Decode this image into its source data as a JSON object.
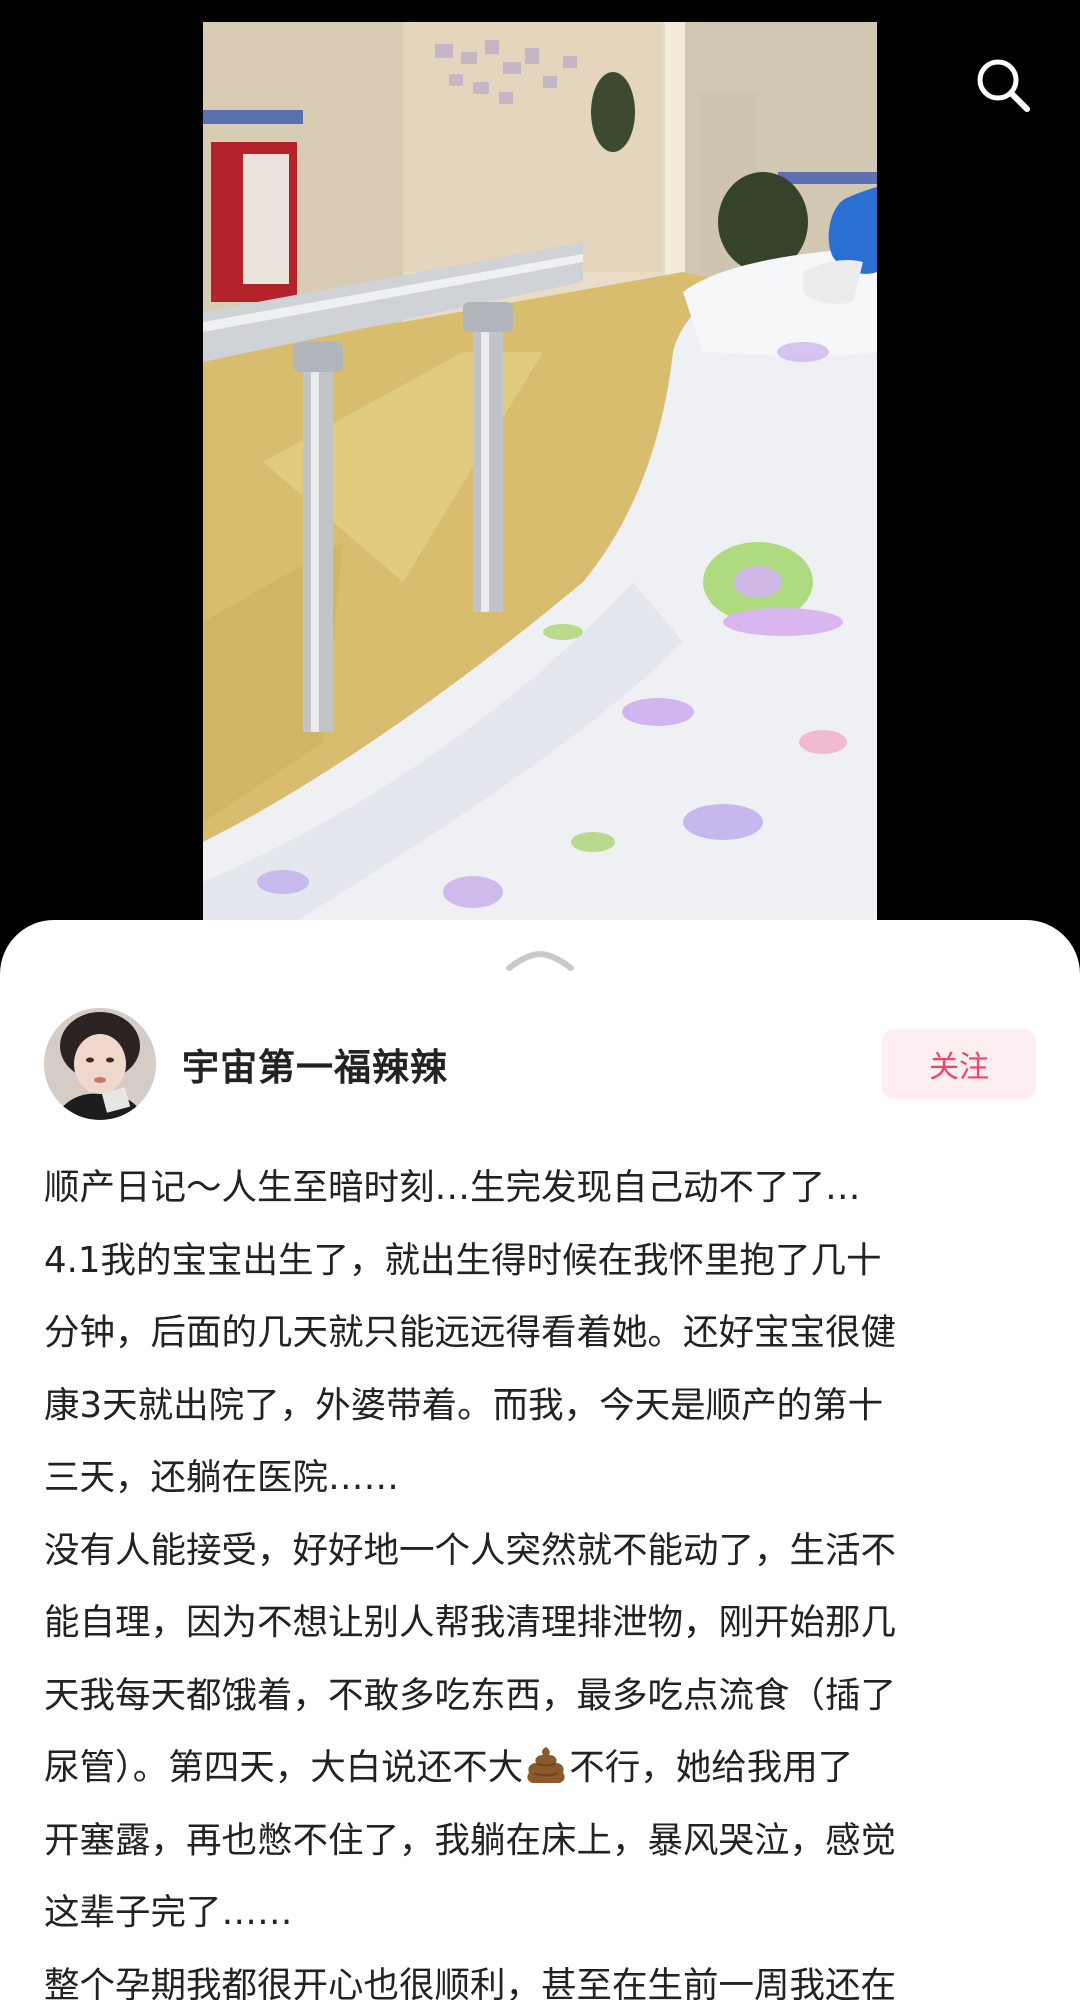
{
  "search": {
    "icon": "search-icon"
  },
  "sheet": {
    "handle_icon": "chevron-up-icon"
  },
  "author": {
    "name": "宇宙第一福辣辣",
    "follow_label": "关注"
  },
  "post": {
    "lines": [
      "顺产日记～人生至暗时刻…生完发现自己动不了了…",
      "4.1我的宝宝出生了，就出生得时候在我怀里抱了几十",
      "分钟，后面的几天就只能远远得看着她。还好宝宝很健",
      "康3天就出院了，外婆带着。而我，今天是顺产的第十",
      "三天，还躺在医院……",
      "没有人能接受，好好地一个人突然就不能动了，生活不",
      "能自理，因为不想让别人帮我清理排泄物，刚开始那几",
      "天我每天都饿着，不敢多吃东西，最多吃点流食（插了",
      {
        "before": "尿管）。第四天，大白说还不大",
        "emoji": "poop-emoji",
        "after": "不行，她给我用了"
      },
      "开塞露，再也憋不住了，我躺在床上，暴风哭泣，感觉",
      "这辈子完了……",
      "整个孕期我都很开心也很顺利，甚至在生前一周我还在"
    ]
  },
  "colors": {
    "follow_text": "#f0456a",
    "follow_bg": "#fdeef1",
    "background": "#000000",
    "sheet": "#ffffff"
  }
}
